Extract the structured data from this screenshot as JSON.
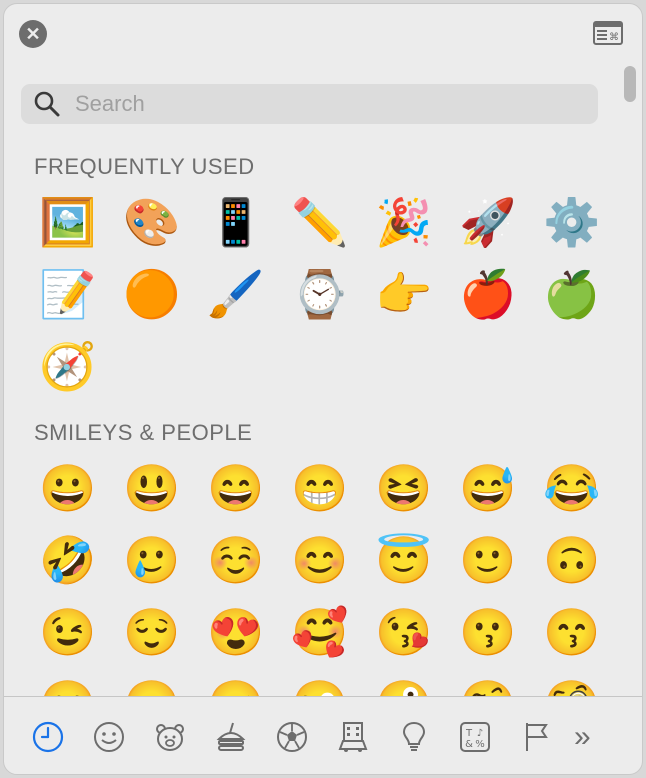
{
  "icons": {
    "close": "close-icon",
    "viewer": "character-viewer-icon",
    "search": "magnifier-icon"
  },
  "search": {
    "placeholder": "Search",
    "value": ""
  },
  "sections": [
    {
      "title": "FREQUENTLY USED",
      "emojis": [
        "🖼️",
        "🎨",
        "📱",
        "✏️",
        "🎉",
        "🚀",
        "⚙️",
        "📝",
        "🟠",
        "🖌️",
        "⌚",
        "👉",
        "🍎",
        "🍏",
        "🧭"
      ]
    },
    {
      "title": "SMILEYS & PEOPLE",
      "emojis": [
        "😀",
        "😃",
        "😄",
        "😁",
        "😆",
        "😅",
        "😂",
        "🤣",
        "🥲",
        "☺️",
        "😊",
        "😇",
        "🙂",
        "🙃",
        "😉",
        "😌",
        "😍",
        "🥰",
        "😘",
        "😗",
        "😙",
        "😋",
        "😛",
        "😝",
        "😜",
        "🤪",
        "🤨",
        "🧐"
      ]
    }
  ],
  "tabs": [
    {
      "name": "recent",
      "icon": "clock-icon",
      "active": true
    },
    {
      "name": "smileys",
      "icon": "smiley-icon",
      "active": false
    },
    {
      "name": "animals",
      "icon": "bear-icon",
      "active": false
    },
    {
      "name": "food",
      "icon": "food-icon",
      "active": false
    },
    {
      "name": "activity",
      "icon": "soccer-ball-icon",
      "active": false
    },
    {
      "name": "travel",
      "icon": "building-icon",
      "active": false
    },
    {
      "name": "objects",
      "icon": "lightbulb-icon",
      "active": false
    },
    {
      "name": "symbols",
      "icon": "symbols-icon",
      "active": false
    },
    {
      "name": "flags",
      "icon": "flag-icon",
      "active": false
    }
  ],
  "more_label": "»",
  "colors": {
    "accent": "#1a73e8",
    "icon_gray": "#6d6d6d"
  }
}
